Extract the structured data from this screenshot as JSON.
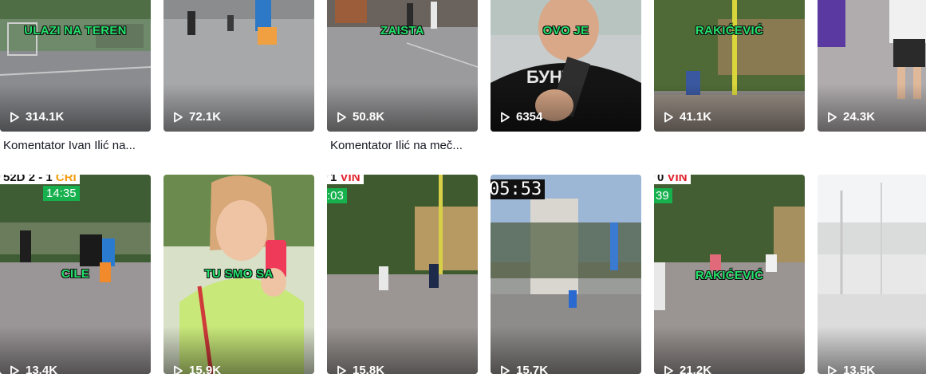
{
  "grid": {
    "row1": [
      {
        "overlay": "ULAZI NA TEREN",
        "views": "314.1K",
        "caption": "Komentator Ivan Ilić na..."
      },
      {
        "overlay": "",
        "views": "72.1K",
        "caption": ""
      },
      {
        "overlay": "ZAISTA",
        "views": "50.8K",
        "caption": "Komentator Ilić na meč..."
      },
      {
        "overlay": "OVO JE",
        "views": "6354",
        "caption": ""
      },
      {
        "overlay": "RAKIĆEVIĆ",
        "views": "41.1K",
        "caption": ""
      },
      {
        "overlay": "",
        "views": "24.3K",
        "caption": ""
      }
    ],
    "row2": [
      {
        "overlay": "CILE",
        "views": "13.4K",
        "scoreboard": {
          "left": "52D",
          "score": "2 - 1",
          "right": "CRI"
        },
        "timer": "14:35"
      },
      {
        "overlay": "TU SMO SA",
        "views": "15.9K"
      },
      {
        "overlay": "",
        "views": "15.8K",
        "scoreboard": {
          "score": "1",
          "right": "VIN"
        },
        "timer": ":03"
      },
      {
        "overlay": "",
        "views": "15.7K",
        "clock": "05:53"
      },
      {
        "overlay": "RAKIĆEVIĆ",
        "views": "21.2K",
        "scoreboard": {
          "score": "0",
          "right": "VIN"
        },
        "timer": "39"
      },
      {
        "overlay": "",
        "views": "13.5K"
      }
    ]
  },
  "icons": {
    "views": "play-outline-icon"
  },
  "colors": {
    "overlay_text": "#22e06a",
    "caption_text": "#161823",
    "timer_bg": "#16b04d",
    "score_red": "#e0202a"
  }
}
